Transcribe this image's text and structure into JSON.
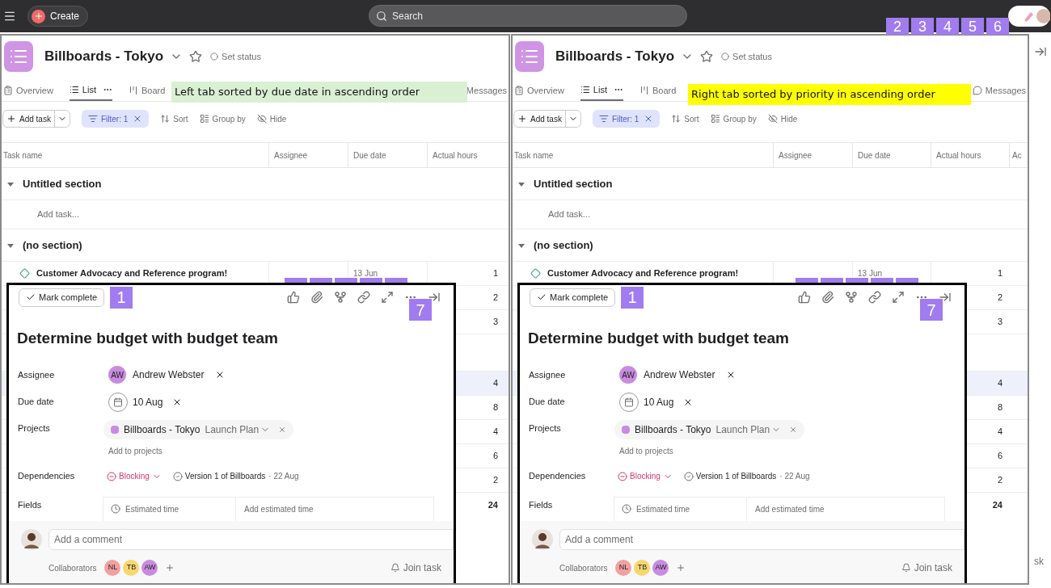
{
  "top_bar": {
    "create": "Create",
    "search": "Search"
  },
  "top_badges": [
    "2",
    "3",
    "4",
    "5",
    "6"
  ],
  "panes": [
    {
      "title": "Billboards - Tokyo",
      "status": "Set status",
      "tabs": [
        {
          "label": "Overview",
          "selected": false,
          "kind": "overview"
        },
        {
          "label": "List",
          "selected": true,
          "kind": "list"
        },
        {
          "label": "Board",
          "selected": false,
          "kind": "board"
        },
        {
          "label": "Messages",
          "selected": false,
          "kind": "plain"
        }
      ],
      "note": {
        "text": "Left tab sorted by due date in ascending order",
        "color": "#d9f0d3"
      },
      "toolbar": {
        "add_task": "Add task",
        "filter": "Filter: 1",
        "sort": "Sort",
        "group_by": "Group by",
        "hide": "Hide"
      },
      "columns": [
        "Task name",
        "Assignee",
        "Due date",
        "Actual hours"
      ],
      "sections": [
        {
          "name": "Untitled section",
          "expanded": true,
          "add_task": "Add task..."
        },
        {
          "name": "(no section)",
          "expanded": true
        }
      ],
      "first_task": {
        "name": "Customer Advocacy and Reference program!",
        "due": "13 Jun",
        "hours": "1"
      },
      "rows": [
        {
          "kind": "task",
          "hours": "2",
          "selected": false
        },
        {
          "kind": "task",
          "hours": "3",
          "selected": false
        },
        {
          "kind": "blank",
          "selected": false
        },
        {
          "kind": "task",
          "hours": "4",
          "selected": true
        },
        {
          "kind": "task",
          "hours": "8",
          "selected": false
        },
        {
          "kind": "task",
          "hours": "4",
          "selected": false
        },
        {
          "kind": "task",
          "hours": "6",
          "selected": false
        },
        {
          "kind": "task",
          "hours": "2",
          "selected": false
        }
      ],
      "total": "24",
      "detail": {
        "mark_complete": "Mark complete",
        "badge": "1",
        "menu_badge": "7",
        "title": "Determine budget with budget team",
        "assignee_label": "Assignee",
        "assignee_initials": "AW",
        "assignee": "Andrew Webster",
        "due_label": "Due date",
        "due": "10 Aug",
        "projects_label": "Projects",
        "project": "Billboards - Tokyo",
        "project_section": "Launch Plan",
        "add_projects": "Add to projects",
        "dependencies_label": "Dependencies",
        "blocking": "Blocking",
        "dependency": "Version 1 of Billboards",
        "dependency_date": "· 22 Aug",
        "fields_label": "Fields",
        "field_name": "Estimated time",
        "field_value": "Add estimated time",
        "comment_placeholder": "Add a comment",
        "collaborators_label": "Collaborators",
        "collaborators": [
          {
            "initials": "NL",
            "color": "#f3a0a0"
          },
          {
            "initials": "TB",
            "color": "#f5d76e"
          },
          {
            "initials": "AW",
            "color": "#c98be0"
          }
        ],
        "join": "Join task"
      }
    },
    {
      "title": "Billboards - Tokyo",
      "status": "Set status",
      "tabs": [
        {
          "label": "Overview",
          "selected": false,
          "kind": "overview"
        },
        {
          "label": "List",
          "selected": true,
          "kind": "list"
        },
        {
          "label": "Board",
          "selected": false,
          "kind": "board"
        },
        {
          "label": "Messages",
          "selected": false,
          "kind": "messages"
        }
      ],
      "note": {
        "text": "Right tab sorted by priority in ascending order",
        "color": "#ffff00"
      },
      "toolbar": {
        "add_task": "Add task",
        "filter": "Filter: 1",
        "sort": "Sort",
        "group_by": "Group by",
        "hide": "Hide"
      },
      "columns": [
        "Task name",
        "Assignee",
        "Due date",
        "Actual hours",
        "Ac"
      ],
      "sections": [
        {
          "name": "Untitled section",
          "expanded": true,
          "add_task": "Add task..."
        },
        {
          "name": "(no section)",
          "expanded": true
        }
      ],
      "first_task": {
        "name": "Customer Advocacy and Reference program!",
        "due": "13 Jun",
        "hours": "1"
      },
      "rows": [
        {
          "kind": "task",
          "hours": "2",
          "selected": false
        },
        {
          "kind": "task",
          "hours": "3",
          "selected": false
        },
        {
          "kind": "blank",
          "selected": false
        },
        {
          "kind": "task",
          "hours": "4",
          "selected": true
        },
        {
          "kind": "task",
          "hours": "8",
          "selected": false
        },
        {
          "kind": "task",
          "hours": "4",
          "selected": false
        },
        {
          "kind": "task",
          "hours": "6",
          "selected": false
        },
        {
          "kind": "task",
          "hours": "2",
          "selected": false
        }
      ],
      "total": "24",
      "detail": {
        "mark_complete": "Mark complete",
        "badge": "1",
        "menu_badge": "7",
        "title": "Determine budget with budget team",
        "assignee_label": "Assignee",
        "assignee_initials": "AW",
        "assignee": "Andrew Webster",
        "due_label": "Due date",
        "due": "10 Aug",
        "projects_label": "Projects",
        "project": "Billboards - Tokyo",
        "project_section": "Launch Plan",
        "add_projects": "Add to projects",
        "dependencies_label": "Dependencies",
        "blocking": "Blocking",
        "dependency": "Version 1 of Billboards",
        "dependency_date": "· 22 Aug",
        "fields_label": "Fields",
        "field_name": "Estimated time",
        "field_value": "Add estimated time",
        "comment_placeholder": "Add a comment",
        "collaborators_label": "Collaborators",
        "collaborators": [
          {
            "initials": "NL",
            "color": "#f3a0a0"
          },
          {
            "initials": "TB",
            "color": "#f5d76e"
          },
          {
            "initials": "AW",
            "color": "#c98be0"
          }
        ],
        "join": "Join task"
      }
    }
  ],
  "edge_text": "sk"
}
